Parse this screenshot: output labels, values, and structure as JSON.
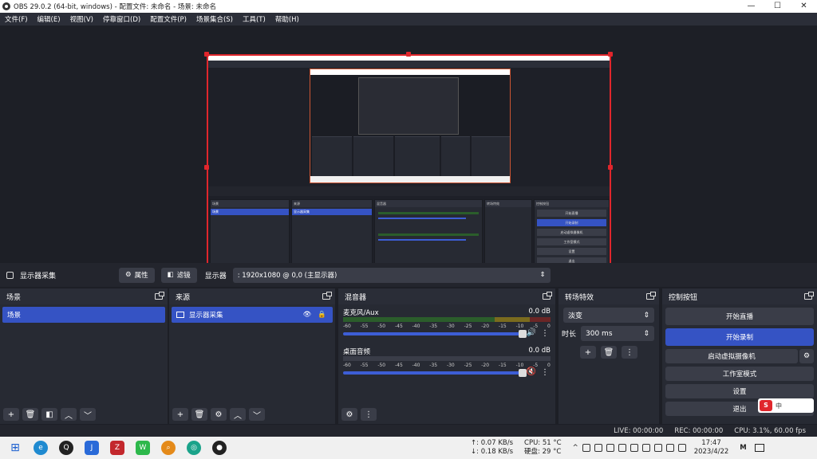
{
  "window": {
    "title": "OBS 29.0.2 (64-bit, windows) - 配置文件: 未命名 - 场景: 未命名",
    "controls": {
      "minimize": "—",
      "maximize": "☐",
      "close": "✕"
    }
  },
  "menu": [
    "文件(F)",
    "编辑(E)",
    "视图(V)",
    "停靠窗口(D)",
    "配置文件(P)",
    "场景集合(S)",
    "工具(T)",
    "帮助(H)"
  ],
  "source_bar": {
    "source_name": "显示器采集",
    "properties_label": "属性",
    "filters_label": "滤镜",
    "display_label": "显示器",
    "display_value": ": 1920x1080 @ 0,0 (主显示器)"
  },
  "scenes": {
    "title": "场景",
    "items": [
      "场景"
    ]
  },
  "sources": {
    "title": "来源",
    "items": [
      "显示器采集"
    ]
  },
  "mixer": {
    "title": "混音器",
    "ticks": [
      "-60",
      "-55",
      "-50",
      "-45",
      "-40",
      "-35",
      "-30",
      "-25",
      "-20",
      "-15",
      "-10",
      "-5",
      "0"
    ],
    "channels": [
      {
        "name": "麦克风/Aux",
        "db": "0.0 dB",
        "muted": false
      },
      {
        "name": "桌面音频",
        "db": "0.0 dB",
        "muted": true
      }
    ]
  },
  "transitions": {
    "title": "转场特效",
    "selected": "淡变",
    "duration_label": "时长",
    "duration_value": "300 ms"
  },
  "controls": {
    "title": "控制按钮",
    "buttons": [
      "开始直播",
      "开始录制",
      "启动虚拟摄像机",
      "工作室模式",
      "设置",
      "退出"
    ],
    "ime": "中"
  },
  "status": {
    "live": "LIVE: 00:00:00",
    "rec": "REC: 00:00:00",
    "cpu": "CPU: 3.1%, 60.00 fps"
  },
  "taskbar": {
    "net_up": "↑: 0.07 KB/s",
    "net_down": "↓: 0.18 KB/s",
    "cpu_temp": "CPU: 51 °C",
    "disk_temp": "硬盘: 29 °C",
    "time": "17:47",
    "date": "2023/4/22"
  },
  "mini": {
    "scene_title": "场景",
    "source_title": "来源",
    "mixer_title": "混音器",
    "trans_title": "转场特效",
    "ctrl_title": "控制按钮",
    "scene_item": "场景",
    "source_item": "显示器采集",
    "btns": [
      "开始直播",
      "开始录制",
      "启动虚拟摄像机",
      "工作室模式",
      "设置",
      "退出"
    ],
    "status": "LIVE: 00:00:00   REC: 00:00:00   CPU: 3.1%, 60.00 fps"
  },
  "colors": {
    "accent": "#3553c4",
    "selection_border": "#e0262c",
    "panel": "#272a33"
  }
}
